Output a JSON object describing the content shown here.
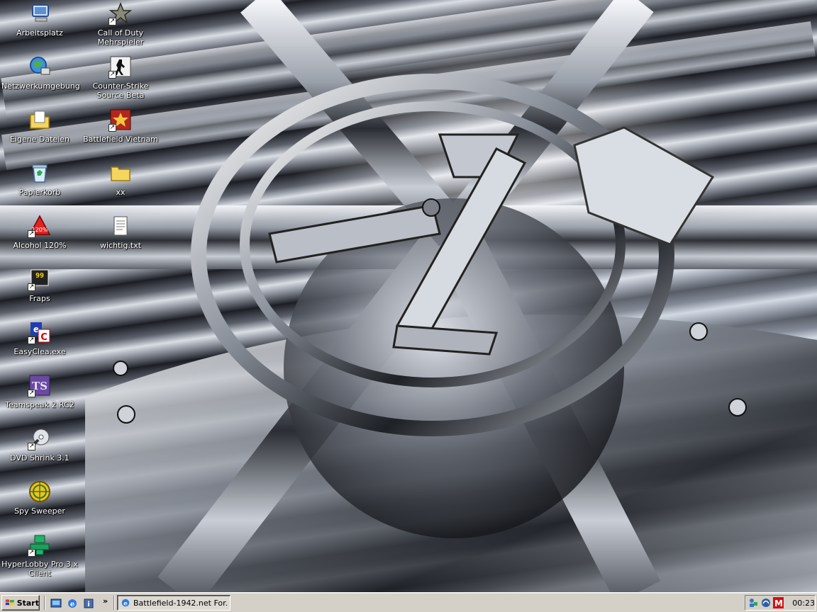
{
  "desktop": {
    "icons": [
      {
        "label": "Arbeitsplatz",
        "icon": "my-computer-icon"
      },
      {
        "label": "Netzwerkumgebung",
        "icon": "network-places-icon"
      },
      {
        "label": "Eigene Dateien",
        "icon": "my-documents-icon"
      },
      {
        "label": "Papierkorb",
        "icon": "recycle-bin-icon"
      },
      {
        "label": "Alcohol 120%",
        "icon": "alcohol-120-icon"
      },
      {
        "label": "Fraps",
        "icon": "fraps-icon"
      },
      {
        "label": "EasyClea.exe",
        "icon": "easyclea-icon"
      },
      {
        "label": "Teamspeak 2 RC2",
        "icon": "teamspeak-icon"
      },
      {
        "label": "DVD Shrink 3.1",
        "icon": "dvd-shrink-icon"
      },
      {
        "label": "Spy Sweeper",
        "icon": "spy-sweeper-icon"
      },
      {
        "label": "HyperLobby Pro 3.x Client",
        "icon": "hyperlobby-icon"
      },
      {
        "label": "Call of Duty Mehrspieler",
        "icon": "call-of-duty-icon"
      },
      {
        "label": "Counter-Strike Source Beta",
        "icon": "counter-strike-icon"
      },
      {
        "label": "Battlefield Vietnam",
        "icon": "battlefield-vietnam-icon"
      },
      {
        "label": "xx",
        "icon": "folder-icon"
      },
      {
        "label": "wichtig.txt",
        "icon": "text-file-icon"
      }
    ]
  },
  "taskbar": {
    "start_label": "Start",
    "quick_launch_more": "»",
    "task_label": "Battlefield-1942.net For...",
    "clock": "00:23"
  },
  "colors": {
    "taskbar": "#d4d0c8",
    "tray_red": "#d01010"
  }
}
